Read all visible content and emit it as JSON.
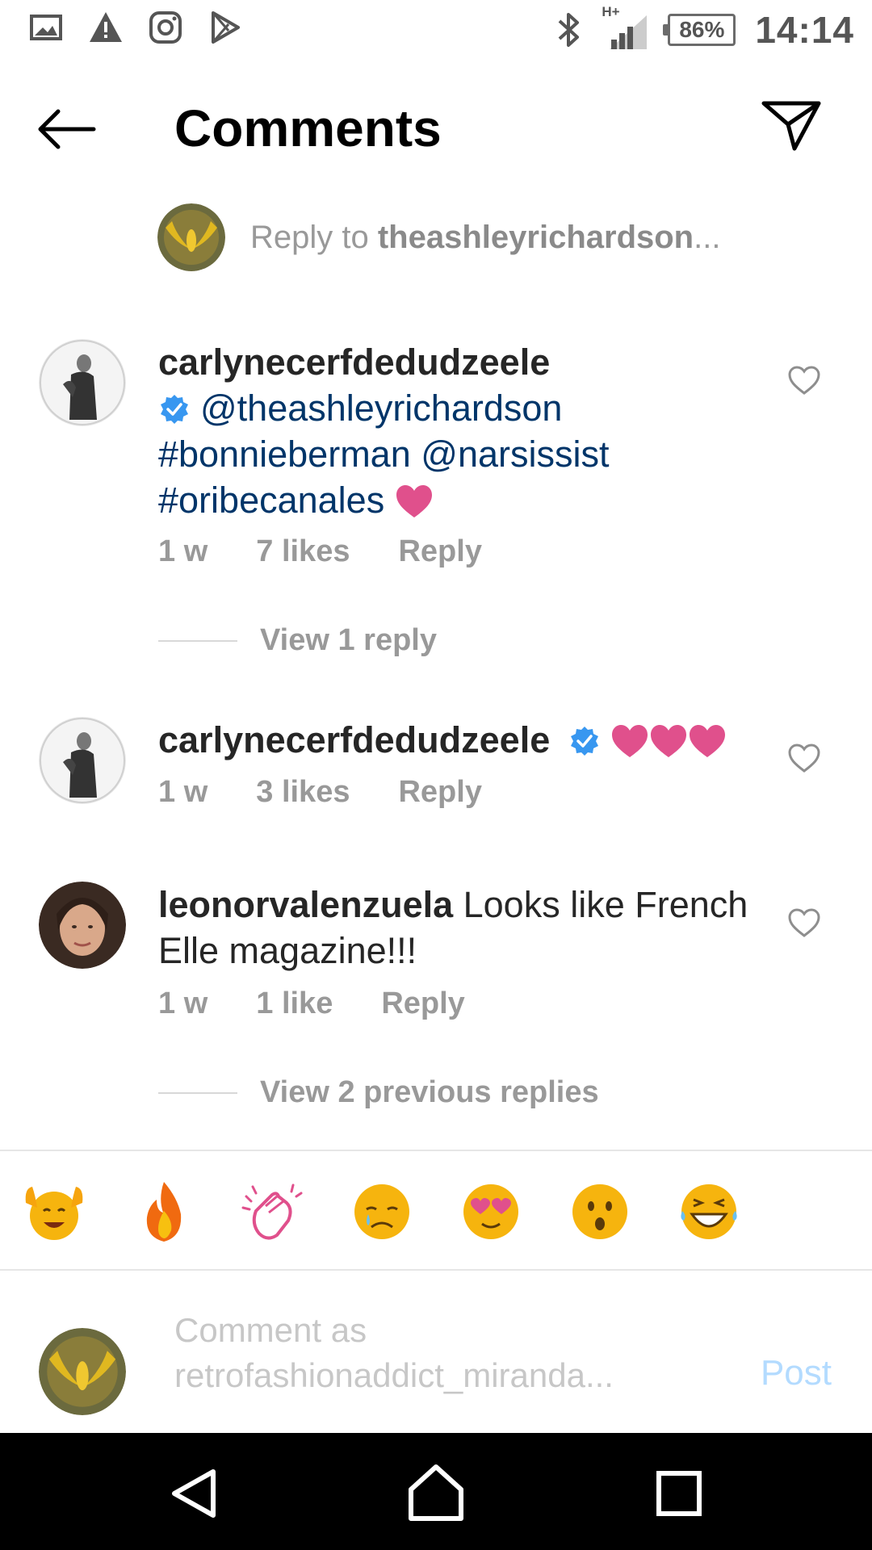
{
  "status_bar": {
    "network": "H+",
    "battery": "86%",
    "time": "14:14",
    "left_icons": [
      "gallery-icon",
      "warning-icon",
      "instagram-icon",
      "play-store-icon"
    ],
    "right_icons": [
      "bluetooth-icon",
      "signal-icon"
    ]
  },
  "header": {
    "title": "Comments"
  },
  "reply_banner": {
    "prefix": "Reply to ",
    "username": "theashleyrichardson",
    "suffix": "..."
  },
  "comments": [
    {
      "username": "carlynecerfdedudzeele",
      "verified": true,
      "mention1": "@theashleyrichardson",
      "tag1": "#bonnieberman",
      "mention2": "@narsissist",
      "tag2": "#oribecanales",
      "time": "1 w",
      "likes": "7 likes",
      "reply_label": "Reply",
      "view_replies": "View 1 reply"
    },
    {
      "username": "carlynecerfdedudzeele",
      "verified": true,
      "time": "1 w",
      "likes": "3 likes",
      "reply_label": "Reply"
    },
    {
      "username": "leonorvalenzuela",
      "text": " Looks like French Elle magazine!!!",
      "time": "1 w",
      "likes": "1 like",
      "reply_label": "Reply",
      "view_replies": "View 2 previous replies"
    }
  ],
  "emoji_bar": [
    "raising-hands",
    "fire",
    "clapping-hands",
    "crying-face",
    "heart-eyes",
    "surprised-face",
    "laughing-face"
  ],
  "comment_input": {
    "placeholder_line1": "Comment as",
    "placeholder_line2": "retrofashionaddict_miranda...",
    "post_label": "Post"
  },
  "colors": {
    "link": "#003569",
    "verified": "#3897f0",
    "heart_emoji": "#e0508c",
    "muted": "#999999",
    "post": "#b3dbff"
  }
}
